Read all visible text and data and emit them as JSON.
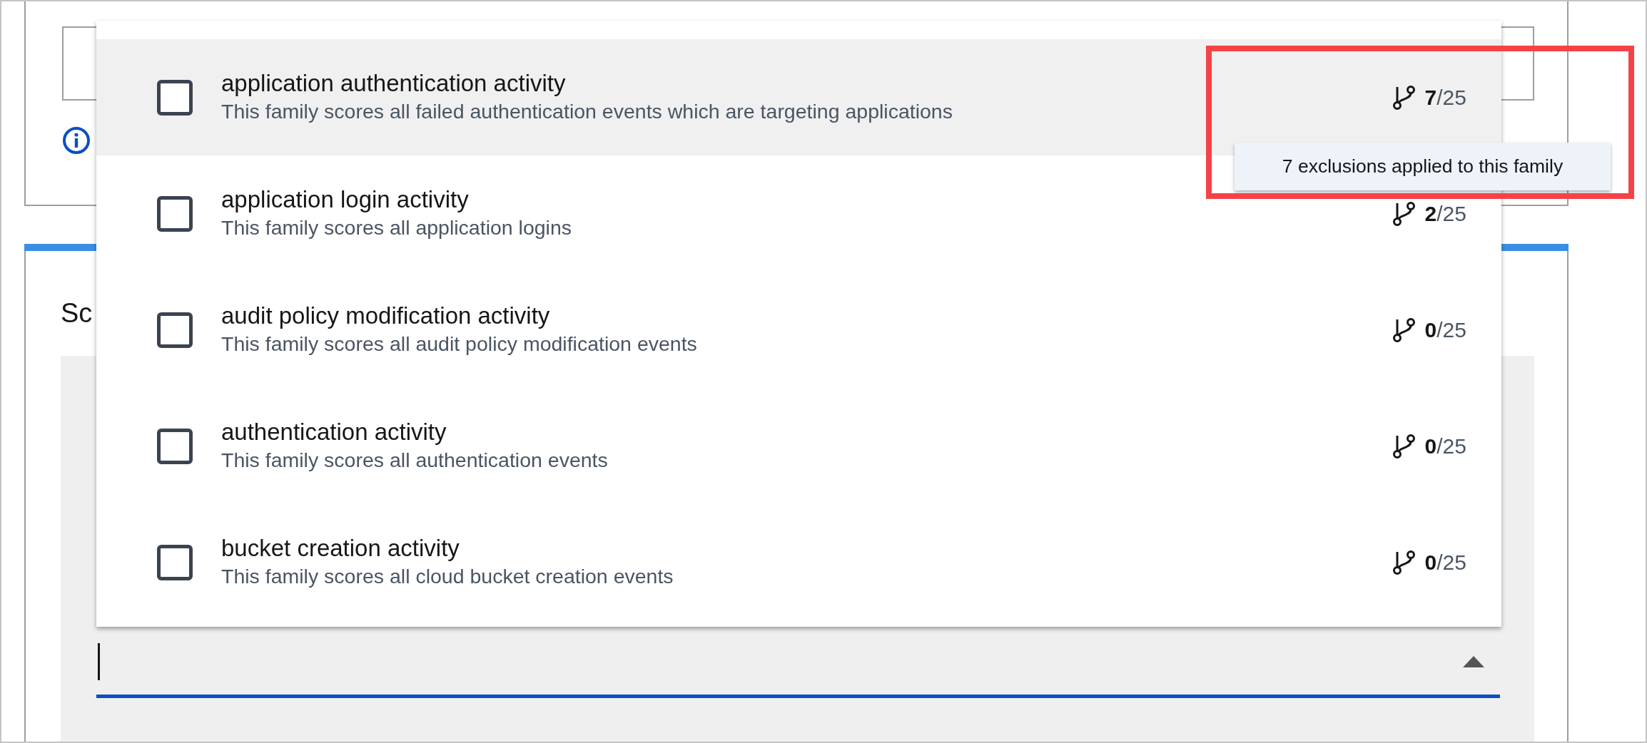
{
  "section_heading": "Sc",
  "families": [
    {
      "title": "application authentication activity",
      "description": "This family scores all failed authentication events which are targeting applications",
      "count": "7",
      "total": "/25",
      "checked": false,
      "highlighted": true
    },
    {
      "title": "application login activity",
      "description": "This family scores all application logins",
      "count": "2",
      "total": "/25",
      "checked": false,
      "highlighted": false
    },
    {
      "title": "audit policy modification activity",
      "description": "This family scores all audit policy modification events",
      "count": "0",
      "total": "/25",
      "checked": false,
      "highlighted": false
    },
    {
      "title": "authentication activity",
      "description": "This family scores all authentication events",
      "count": "0",
      "total": "/25",
      "checked": false,
      "highlighted": false
    },
    {
      "title": "bucket creation activity",
      "description": "This family scores all cloud bucket creation events",
      "count": "0",
      "total": "/25",
      "checked": false,
      "highlighted": false
    }
  ],
  "tooltip": {
    "text": "7 exclusions applied to this family"
  },
  "family_field": {
    "expanded": true
  }
}
